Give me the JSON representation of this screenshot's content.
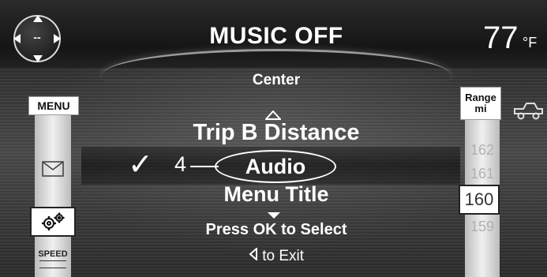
{
  "header": {
    "compass_heading": "--",
    "title": "MUSIC OFF",
    "temperature": "77",
    "temperature_unit": "°F"
  },
  "left_menu": {
    "menu_label": "MENU",
    "items": [
      "mail-icon",
      "settings-gear-icon",
      "speed-icon"
    ],
    "speed_label": "SPEED",
    "selected_item": "settings-gear-icon"
  },
  "right_panel": {
    "range_label_line1": "Range",
    "range_label_line2": "mi",
    "range_values": [
      "162",
      "161",
      "160",
      "159"
    ],
    "selected_value": "160",
    "vehicle_icon": "truck-icon"
  },
  "menu": {
    "header_label": "Center",
    "prev_item": "Trip B Distance",
    "selected_index": "4",
    "selected_item": "Audio",
    "next_item": "Menu Title",
    "checkmark": "✓",
    "instruction": "Press OK to Select",
    "exit_text": "to Exit"
  },
  "colors": {
    "text": "#ffffff",
    "background": "#3e3e3e",
    "panel": "#f0f0f0"
  }
}
